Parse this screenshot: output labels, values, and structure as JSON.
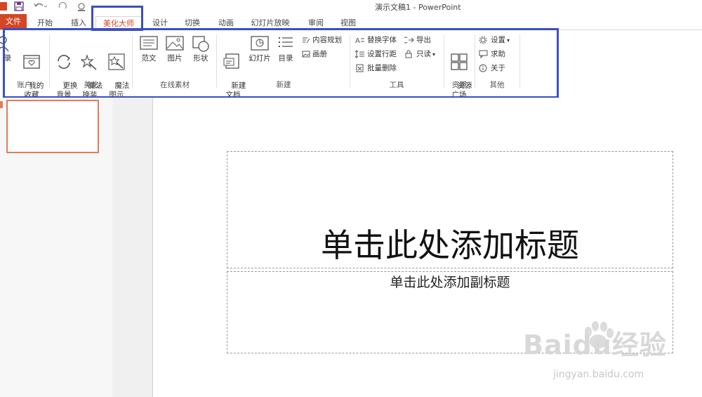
{
  "window": {
    "title": "演示文稿1 - PowerPoint"
  },
  "quick_access": {
    "icons": [
      "powerpoint-logo-icon",
      "save-icon",
      "undo-icon",
      "redo-icon",
      "touch-mode-icon"
    ]
  },
  "tabs": {
    "file": "文件",
    "items": [
      "开始",
      "插入",
      "美化大师",
      "设计",
      "切换",
      "动画",
      "幻灯片放映",
      "审阅",
      "视图"
    ],
    "active": "美化大师"
  },
  "ribbon": {
    "account": {
      "label": "账户",
      "login": "登录",
      "login_partial": "录",
      "favorites": "我的\n收藏"
    },
    "beautify": {
      "label": "美化",
      "change_bg": "更换\n背景",
      "magic_change": "魔法\n换装",
      "magic_diagram": "魔法\n图示"
    },
    "online": {
      "label": "在线素材",
      "template": "范文",
      "picture": "图片",
      "shape": "形状"
    },
    "new": {
      "label": "新建",
      "new_doc": "新建\n文档",
      "slide": "幻灯片",
      "toc": "目录",
      "content_plan": "内容规划",
      "album": "画册"
    },
    "tools": {
      "label": "工具",
      "replace_font": "替换字体",
      "line_spacing": "设置行距",
      "batch_delete": "批量删除",
      "export": "导出",
      "read_only": "只读"
    },
    "resources": {
      "label": "资源",
      "resource_plaza": "资源\n广场"
    },
    "other": {
      "label": "其他",
      "settings": "设置",
      "help": "求助",
      "about": "关于"
    }
  },
  "slide": {
    "title_placeholder": "单击此处添加标题",
    "subtitle_placeholder": "单击此处添加副标题"
  },
  "watermark": {
    "brand": "Baidu经验",
    "url": "jingyan.baidu.com"
  },
  "colors": {
    "accent": "#d24726",
    "highlight": "#3a4fc4"
  }
}
